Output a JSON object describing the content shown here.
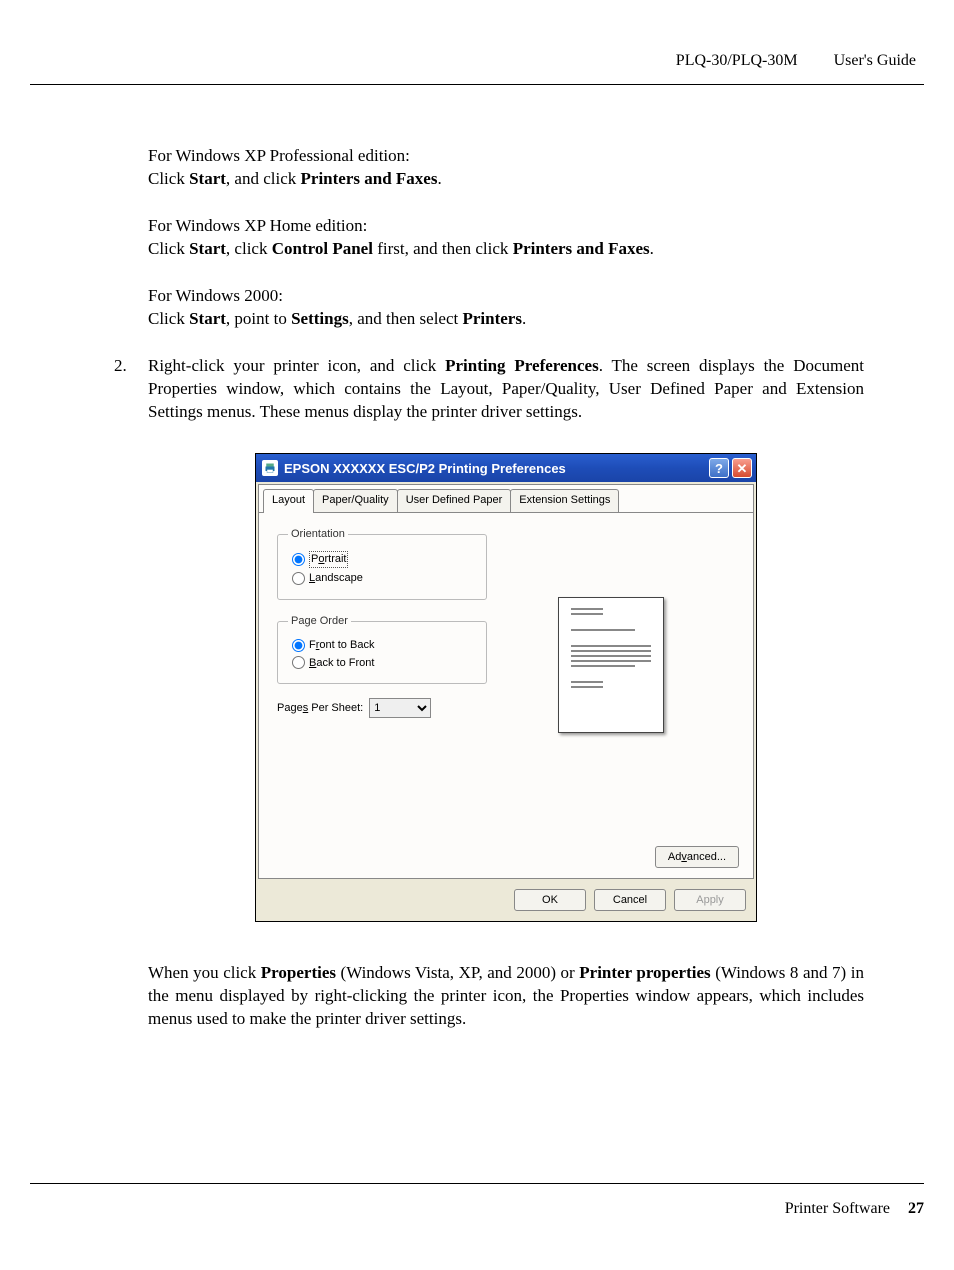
{
  "header": {
    "model": "PLQ-30/PLQ-30M",
    "guide": "User's Guide"
  },
  "body": {
    "xp_pro_intro": "For Windows XP Professional edition:",
    "xp_pro_click": "Click ",
    "start": "Start",
    "and_click": ", and click ",
    "printers_faxes": "Printers and Faxes",
    "period": ".",
    "xp_home_intro": "For Windows XP Home edition:",
    "xp_home_line_a": "Click ",
    "xp_home_line_b": ", click ",
    "control_panel": "Control Panel",
    "xp_home_line_c": " first, and then click ",
    "w2000_intro": "For Windows 2000:",
    "w2000_a": "Click ",
    "w2000_b": ", point to ",
    "settings": "Settings",
    "w2000_c": ", and then select ",
    "printers": "Printers",
    "step2_num": "2.",
    "step2_a": "Right-click your printer icon, and click ",
    "printing_prefs": "Printing Preferences",
    "step2_b": ". The screen displays the Document Properties window, which contains the Layout, Paper/Quality, User Defined Paper and Extension Settings menus. These menus display the printer driver settings.",
    "after_a": "When you click ",
    "properties": "Properties",
    "after_b": " (Windows Vista, XP, and 2000) or ",
    "printer_properties": "Printer properties",
    "after_c": " (Windows 8 and 7) in the menu displayed by right-clicking the printer icon, the Properties window appears, which includes menus used to make the printer driver settings."
  },
  "dialog": {
    "title": "EPSON XXXXXX ESC/P2 Printing Preferences",
    "help_symbol": "?",
    "close_symbol": "✕",
    "tabs": {
      "layout": "Layout",
      "paper_quality": "Paper/Quality",
      "user_defined": "User Defined Paper",
      "extension": "Extension Settings"
    },
    "orientation": {
      "legend": "Orientation",
      "portrait": "Portrait",
      "landscape": "Landscape"
    },
    "page_order": {
      "legend": "Page Order",
      "front_to_back": "Front to Back",
      "back_to_front": "Back to Front"
    },
    "pages_per_sheet": {
      "label": "Pages Per Sheet:",
      "value": "1"
    },
    "advanced": "Advanced...",
    "ok": "OK",
    "cancel": "Cancel",
    "apply": "Apply"
  },
  "footer": {
    "section": "Printer Software",
    "page": "27"
  }
}
